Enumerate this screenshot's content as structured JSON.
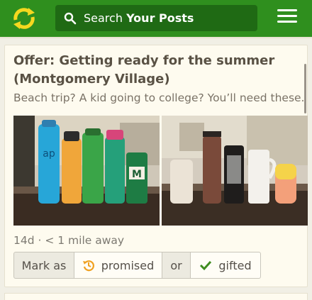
{
  "header": {
    "search": {
      "prefix": "Search ",
      "emphasis": "Your Posts"
    }
  },
  "post": {
    "title": "Offer: Getting ready for the summer (Montgomery Village)",
    "description": "Beach trip? A kid going to college? You’ll need these...",
    "meta": "14d · < 1 mile away",
    "actions": {
      "mark_as": "Mark as",
      "promised": "promised",
      "or": "or",
      "gifted": "gifted"
    }
  },
  "colors": {
    "brand_green": "#2f8f1e",
    "search_bg": "#1f6a14",
    "logo_yellow": "#f5d81f",
    "promised_orange": "#f0a020",
    "gifted_green": "#3f8c1f"
  }
}
